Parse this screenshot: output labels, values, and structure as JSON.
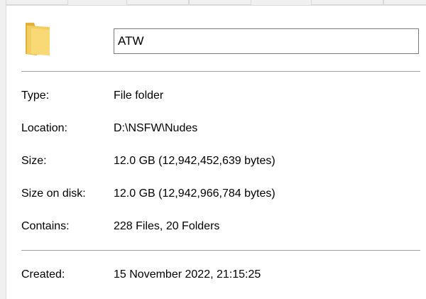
{
  "general": {
    "folder_name": "ATW",
    "folder_icon": "folder-icon",
    "rows": [
      {
        "label": "Type:",
        "value": "File folder"
      },
      {
        "label": "Location:",
        "value": "D:\\NSFW\\Nudes"
      },
      {
        "label": "Size:",
        "value": "12.0 GB (12,942,452,639 bytes)"
      },
      {
        "label": "Size on disk:",
        "value": "12.0 GB (12,942,966,784 bytes)"
      },
      {
        "label": "Contains:",
        "value": "228 Files, 20 Folders"
      }
    ],
    "created": {
      "label": "Created:",
      "value": "15 November 2022, 21:15:25"
    }
  },
  "colors": {
    "folder_back": "#e6b740",
    "folder_front": "#f5d168",
    "divider": "#a0a0a0"
  }
}
